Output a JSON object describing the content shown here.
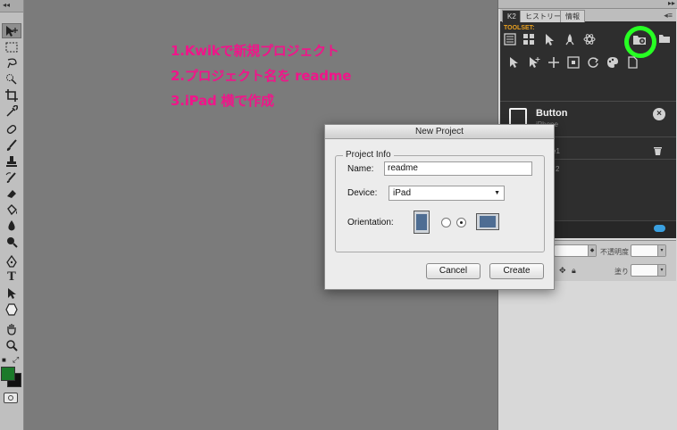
{
  "annotation": {
    "line1": "1.Kwikで新規プロジェクト",
    "line2": "2.プロジェクト名を readme",
    "line3": "3.iPad 横で作成",
    "color": "#f0158a"
  },
  "panel": {
    "tabs": [
      "K2",
      "ヒストリー",
      "情報"
    ],
    "toolset_label": "TOOLSET:",
    "item_title": "Button",
    "item_subtitle": "iPhone",
    "row1_text": "e1",
    "row2_text": "2",
    "opacity_label": "不透明度",
    "fill_label": "塗り",
    "highlight_color": "#27ff23"
  },
  "dialog": {
    "title": "New Project",
    "section": "Project Info",
    "name_label": "Name:",
    "name_value": "readme",
    "device_label": "Device:",
    "device_value": "iPad",
    "orientation_label": "Orientation:",
    "orientation_selected": "landscape",
    "cancel_label": "Cancel",
    "create_label": "Create"
  },
  "toolbar": {
    "foreground_color": "#1b7a2a",
    "background_color": "#111111",
    "tools": [
      "move",
      "marquee",
      "lasso",
      "quick-select",
      "crop",
      "eyedropper",
      "healing",
      "brush",
      "stamp",
      "history-brush",
      "eraser",
      "paint-bucket",
      "blur",
      "dodge",
      "pen",
      "type",
      "path-select",
      "shape",
      "hand",
      "zoom"
    ]
  }
}
